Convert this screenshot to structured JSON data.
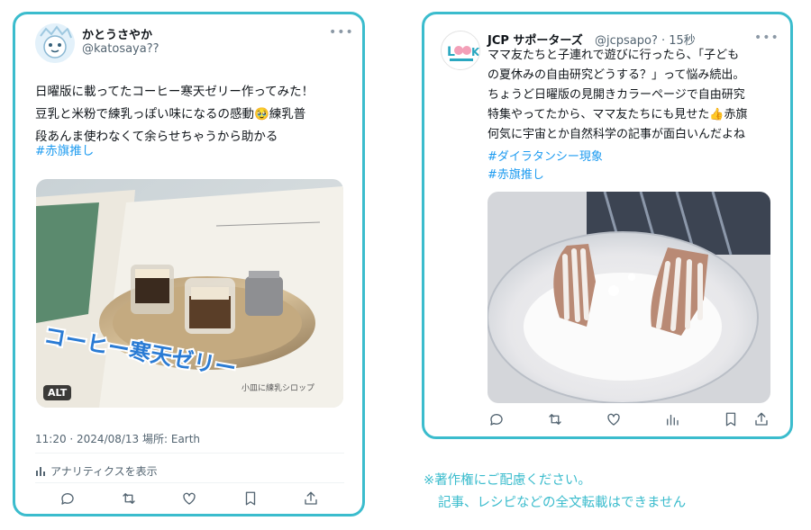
{
  "tweet1": {
    "display_name": "かとうさやか",
    "handle": "@katosaya??",
    "more_icon": "more-dots-icon",
    "text": "日曜版に載ってたコーヒー寒天ゼリー作ってみた！\n豆乳と米粉で練乳っぽい味になるの感動🥹練乳普\n段あんま使わなくて余らせちゃうから助かる",
    "hashtags": [
      "#赤旗推し"
    ],
    "media": {
      "alt_badge": "ALT",
      "magazine_title": "コーヒー寒天ゼリー",
      "side_caption": "小皿に練乳シロップ"
    },
    "timestamp": "11:20 · 2024/08/13 場所: Earth",
    "analytics_label": "アナリティクスを表示",
    "actions": [
      "reply-icon",
      "retweet-icon",
      "like-icon",
      "bookmark-icon",
      "share-icon"
    ]
  },
  "tweet2": {
    "display_name": "JCP サポーターズ",
    "handle": "@jcpsapo? · 15秒",
    "text": "ママ友たちと子連れで遊びに行ったら、「子ども\nの夏休みの自由研究どうする？」って悩み続出。\nちょうど日曜版の見開きカラーページで自由研究\n特集やってたから、ママ友たちにも見せた👍赤旗\n何気に宇宙とか自然科学の記事が面白いんだよね",
    "hashtags": [
      "#ダイラタンシー現象",
      "#赤旗推し"
    ],
    "actions": [
      "reply-icon",
      "retweet-icon",
      "like-icon",
      "views-icon",
      "bookmark-icon",
      "share-icon"
    ]
  },
  "notice": {
    "line1": "※著作権にご配慮ください。",
    "line2": "記事、レシピなどの全文転載はできません"
  },
  "colors": {
    "accent_border": "#3bbccd",
    "hashtag": "#1d9bf0",
    "muted": "#536471"
  }
}
